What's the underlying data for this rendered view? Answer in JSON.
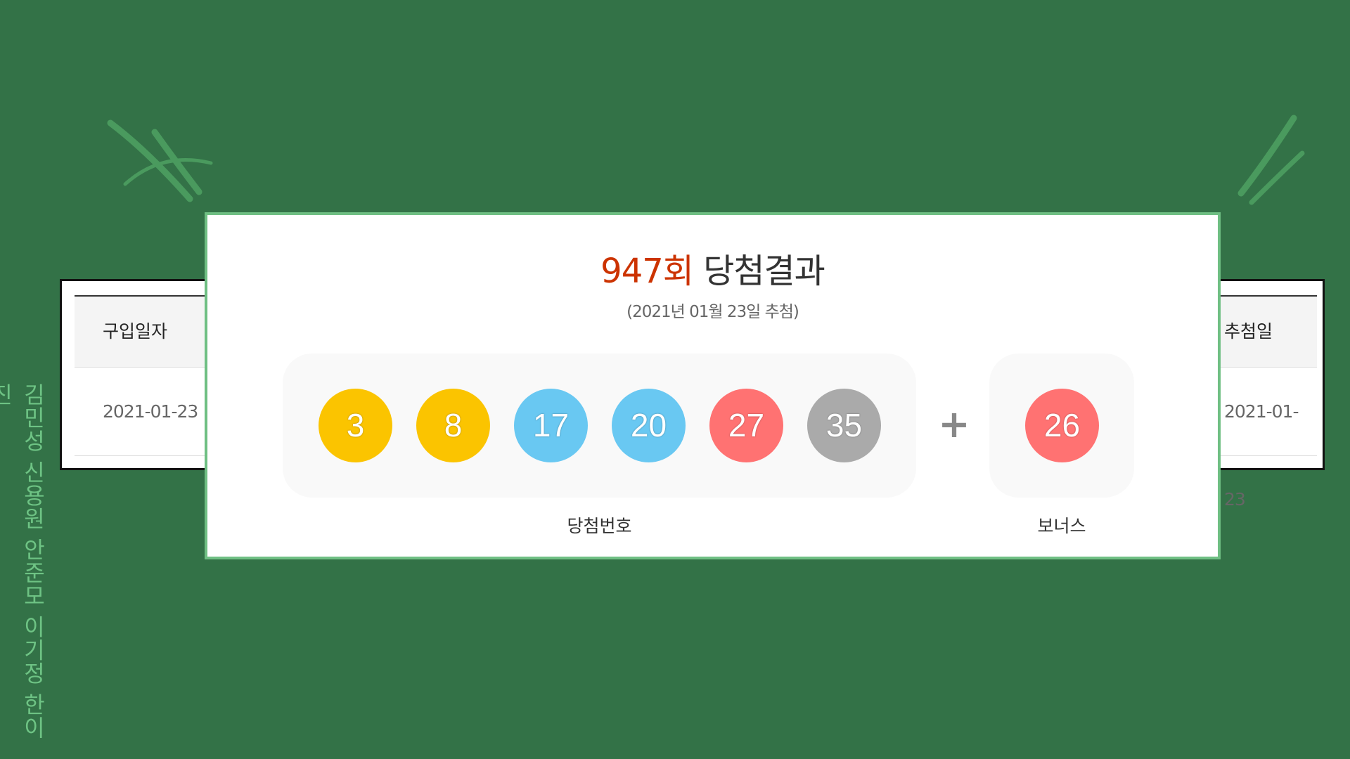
{
  "colors": {
    "background": "#337247",
    "card_border": "#6fbf83",
    "round_accent": "#cc3300",
    "ball_yellow": "#fbc400",
    "ball_blue": "#69c8f2",
    "ball_red": "#ff7272",
    "ball_gray": "#aaaaaa"
  },
  "back_table": {
    "headers": {
      "left": "구입일자",
      "right": "추첨일"
    },
    "row": {
      "left": "2021-01-23",
      "right": "2021-01-23"
    }
  },
  "result": {
    "round": "947회",
    "title_suffix": "당첨결과",
    "draw_date": "(2021년 01월 23일 추첨)",
    "numbers": [
      {
        "value": "3",
        "color": "#fbc400"
      },
      {
        "value": "8",
        "color": "#fbc400"
      },
      {
        "value": "17",
        "color": "#69c8f2"
      },
      {
        "value": "20",
        "color": "#69c8f2"
      },
      {
        "value": "27",
        "color": "#ff7272"
      },
      {
        "value": "35",
        "color": "#aaaaaa"
      }
    ],
    "plus": "+",
    "bonus": {
      "value": "26",
      "color": "#ff7272"
    },
    "numbers_label": "당첨번호",
    "bonus_label": "보너스"
  },
  "side_names": "김민성 신용원 안준모 이기정 한이진"
}
